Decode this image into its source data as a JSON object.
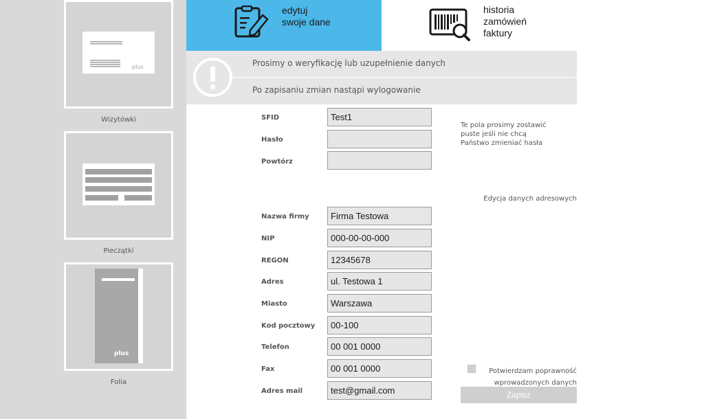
{
  "sidebar": {
    "items": [
      {
        "label": "Wizytówki"
      },
      {
        "label": "Pieczątki"
      },
      {
        "label": "Folia"
      }
    ],
    "logo_text": "plus"
  },
  "tabs": {
    "edit": {
      "line1": "edytuj",
      "line2": "swoje dane"
    },
    "history": {
      "line1": "historia",
      "line2": "zamówień",
      "line3": "faktury"
    }
  },
  "info": {
    "line1": "Prosimy o weryfikację lub uzupełnienie danych",
    "line2": "Po zapisaniu zmian nastąpi wylogowanie"
  },
  "account": {
    "sfid_label": "SFID",
    "sfid_value": "Test1",
    "password_label": "Hasło",
    "password_value": "",
    "repeat_label": "Powtórz",
    "repeat_value": "",
    "hint": "Te pola prosimy zostawić puste jeśli nie chcą Państwo zmieniać hasła"
  },
  "address_link": "Edycja danych adresowych",
  "address": {
    "fields": [
      {
        "label": "Nazwa firmy",
        "value": "Firma Testowa"
      },
      {
        "label": "NIP",
        "value": "000-00-00-000"
      },
      {
        "label": "REGON",
        "value": "12345678"
      },
      {
        "label": "Adres",
        "value": "ul. Testowa 1"
      },
      {
        "label": "Miasto",
        "value": "Warszawa"
      },
      {
        "label": "Kod pocztowy",
        "value": "00-100"
      },
      {
        "label": "Telefon",
        "value": "00 001 0000"
      },
      {
        "label": "Fax",
        "value": "00 001 0000"
      },
      {
        "label": "Adres mail",
        "value": "test@gmail.com"
      }
    ]
  },
  "confirm": {
    "line1": "Potwierdzam poprawność",
    "line2": "wprowadzonych danych",
    "checked": false
  },
  "save_label": "Zapisz",
  "colors": {
    "accent": "#4cb8ea",
    "sidebar": "#d9d9d9",
    "info_bar": "#e6e6e6"
  }
}
